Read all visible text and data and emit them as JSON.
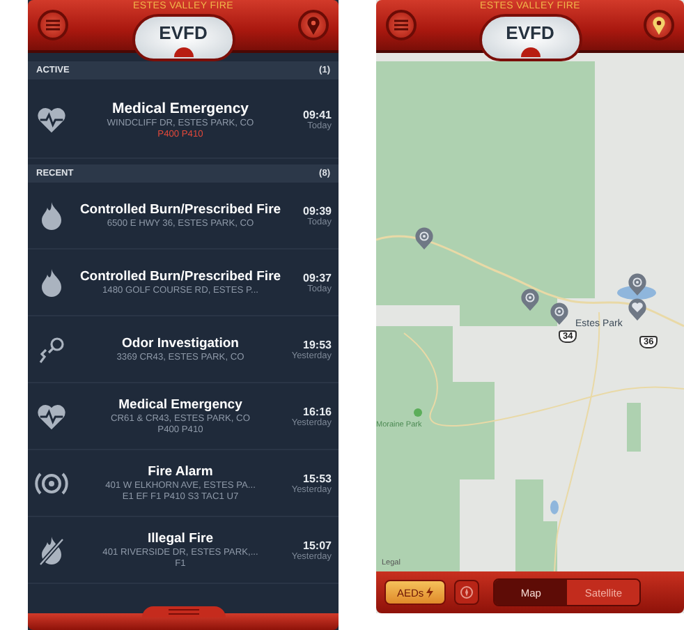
{
  "incidents_screen": {
    "header": {
      "subtitle": "ESTES VALLEY FIRE",
      "logo": "EVFD",
      "locate_on": false
    },
    "sections": [
      {
        "label": "ACTIVE",
        "count": "(1)",
        "kind": "active",
        "incidents": [
          {
            "kind": "heart",
            "title": "Medical Emergency",
            "address": "WINDCLIFF DR, ESTES PARK, CO",
            "units": "P400 P410",
            "time": "09:41",
            "day": "Today"
          }
        ]
      },
      {
        "label": "RECENT",
        "count": "(8)",
        "kind": "recent",
        "incidents": [
          {
            "kind": "flame",
            "title": "Controlled Burn/Prescribed Fire",
            "address": "6500 E HWY 36, ESTES PARK, CO",
            "time": "09:39",
            "day": "Today"
          },
          {
            "kind": "flame",
            "title": "Controlled Burn/Prescribed Fire",
            "address": "1480 GOLF COURSE RD, ESTES P...",
            "time": "09:37",
            "day": "Today"
          },
          {
            "kind": "odor",
            "title": "Odor Investigation",
            "address": "3369 CR43, ESTES PARK, CO",
            "time": "19:53",
            "day": "Yesterday"
          },
          {
            "kind": "heart",
            "title": "Medical Emergency",
            "address": "CR61 & CR43, ESTES PARK, CO",
            "units": "P400 P410",
            "time": "16:16",
            "day": "Yesterday"
          },
          {
            "kind": "alarm",
            "title": "Fire Alarm",
            "address": "401 W ELKHORN AVE, ESTES PA...",
            "units": "E1 EF F1 P410 S3 TAC1 U7",
            "time": "15:53",
            "day": "Yesterday"
          },
          {
            "kind": "illegal",
            "title": "Illegal Fire",
            "address": "401 RIVERSIDE DR, ESTES PARK,...",
            "units": "F1",
            "time": "15:07",
            "day": "Yesterday"
          }
        ]
      }
    ]
  },
  "map_screen": {
    "header": {
      "subtitle": "ESTES VALLEY FIRE",
      "logo": "EVFD",
      "locate_on": true
    },
    "map": {
      "town": "Estes Park",
      "shields": [
        "34",
        "36"
      ],
      "park": "Moraine Park",
      "legal": "Legal",
      "pins": [
        {
          "kind": "alarm"
        },
        {
          "kind": "alarm"
        },
        {
          "kind": "alarm"
        },
        {
          "kind": "alarm"
        },
        {
          "kind": "heart"
        }
      ]
    },
    "toolbar": {
      "aed_button": "AEDs",
      "map_types": [
        {
          "label": "Map",
          "selected": true
        },
        {
          "label": "Satellite",
          "selected": false
        }
      ]
    }
  }
}
